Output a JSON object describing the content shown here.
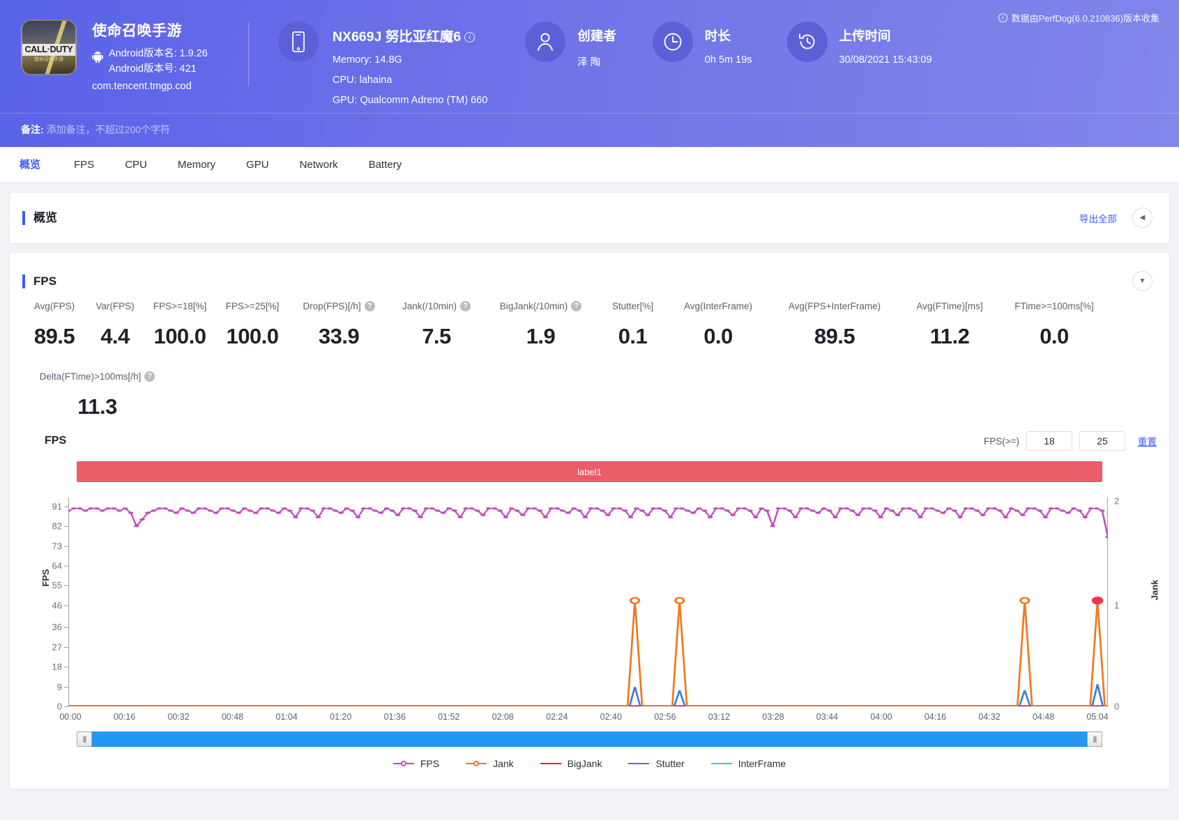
{
  "header": {
    "app": {
      "icon_title": "CALL·DUTY",
      "icon_sub": "使命召唤手游",
      "name": "使命召唤手游",
      "android_icon": "android-icon",
      "version_name": "Android版本名: 1.9.26",
      "version_code": "Android版本号: 421",
      "package": "com.tencent.tmgp.cod"
    },
    "device": {
      "icon": "phone-icon",
      "name": "NX669J 努比亚红魔6",
      "info_icon": "info-icon",
      "memory": "Memory: 14.8G",
      "cpu": "CPU: lahaina",
      "gpu": "GPU: Qualcomm Adreno (TM) 660"
    },
    "creator": {
      "icon": "user-icon",
      "title": "创建者",
      "value": "泽 陶"
    },
    "duration": {
      "icon": "clock-icon",
      "title": "时长",
      "value": "0h 5m 19s"
    },
    "upload": {
      "icon": "history-icon",
      "title": "上传时间",
      "value": "30/08/2021 15:43:09"
    },
    "collect_note": "数据由PerfDog(6.0.210836)版本收集",
    "note_label": "备注:",
    "note_placeholder": "添加备注，不超过200个字符"
  },
  "tabs": [
    {
      "label": "概览",
      "active": true
    },
    {
      "label": "FPS",
      "active": false
    },
    {
      "label": "CPU",
      "active": false
    },
    {
      "label": "Memory",
      "active": false
    },
    {
      "label": "GPU",
      "active": false
    },
    {
      "label": "Network",
      "active": false
    },
    {
      "label": "Battery",
      "active": false
    }
  ],
  "overview_card": {
    "title": "概览",
    "export_label": "导出全部",
    "collapse_icon": "chevron-left-icon"
  },
  "fps_card": {
    "title": "FPS",
    "expand_icon": "chevron-down-icon",
    "metrics": [
      {
        "label": "Avg(FPS)",
        "value": "89.5",
        "help": false
      },
      {
        "label": "Var(FPS)",
        "value": "4.4",
        "help": false
      },
      {
        "label": "FPS>=18[%]",
        "value": "100.0",
        "help": false
      },
      {
        "label": "FPS>=25[%]",
        "value": "100.0",
        "help": false
      },
      {
        "label": "Drop(FPS)[/h]",
        "value": "33.9",
        "help": true
      },
      {
        "label": "Jank(/10min)",
        "value": "7.5",
        "help": true
      },
      {
        "label": "BigJank(/10min)",
        "value": "1.9",
        "help": true
      },
      {
        "label": "Stutter[%]",
        "value": "0.1",
        "help": false
      },
      {
        "label": "Avg(InterFrame)",
        "value": "0.0",
        "help": false
      },
      {
        "label": "Avg(FPS+InterFrame)",
        "value": "89.5",
        "help": false
      },
      {
        "label": "Avg(FTime)[ms]",
        "value": "11.2",
        "help": false
      },
      {
        "label": "FTime>=100ms[%]",
        "value": "0.0",
        "help": false
      }
    ],
    "metrics_row2": [
      {
        "label": "Delta(FTime)>100ms[/h]",
        "value": "11.3",
        "help": true
      }
    ],
    "chart_header": {
      "name": "FPS",
      "fps_ge_label": "FPS(>=)",
      "threshold1": "18",
      "threshold2": "25",
      "reset_label": "重置"
    },
    "label_bar": "label1",
    "scrollbar": {
      "left_handle": "scroll-handle-left",
      "right_handle": "scroll-handle-right"
    }
  },
  "chart_data": {
    "type": "line",
    "title": "FPS",
    "xlabel": "",
    "ylabel": "FPS",
    "y2label": "Jank",
    "ylim": [
      0,
      95
    ],
    "y2lim": [
      0,
      2
    ],
    "yticks": [
      0,
      9,
      18,
      27,
      36,
      46,
      55,
      64,
      73,
      82,
      91
    ],
    "y2ticks": [
      0,
      1,
      2
    ],
    "xticks": [
      "00:00",
      "00:16",
      "00:32",
      "00:48",
      "01:04",
      "01:20",
      "01:36",
      "01:52",
      "02:08",
      "02:24",
      "02:40",
      "02:56",
      "03:12",
      "03:28",
      "03:44",
      "04:00",
      "04:16",
      "04:32",
      "04:48",
      "05:04"
    ],
    "grid": false,
    "legend_position": "bottom",
    "legend": [
      {
        "name": "FPS",
        "color": "#c24bbc",
        "marker": "circle"
      },
      {
        "name": "Jank",
        "color": "#f3761c",
        "marker": "circle"
      },
      {
        "name": "BigJank",
        "color": "#e02020",
        "marker": "line"
      },
      {
        "name": "Stutter",
        "color": "#3a7bd5",
        "marker": "line"
      },
      {
        "name": "InterFrame",
        "color": "#18d8d8",
        "marker": "line"
      }
    ],
    "series": [
      {
        "name": "FPS",
        "color": "#c24bbc",
        "axis": "left",
        "description": "Oscillates between ~82 and ~91 across the whole 5m19s run, with periodic small dips to 82-85 and a trailing drop to ~77 at the end.",
        "values": [
          89,
          90,
          90,
          89,
          90,
          90,
          89,
          90,
          90,
          89,
          90,
          88,
          82,
          85,
          88,
          89,
          90,
          90,
          89,
          88,
          90,
          89,
          88,
          90,
          90,
          89,
          88,
          90,
          90,
          89,
          88,
          90,
          89,
          88,
          90,
          90,
          89,
          88,
          90,
          89,
          86,
          90,
          90,
          89,
          86,
          90,
          90,
          89,
          88,
          90,
          89,
          86,
          90,
          90,
          89,
          88,
          90,
          89,
          87,
          90,
          90,
          89,
          86,
          90,
          90,
          89,
          88,
          90,
          89,
          86,
          90,
          90,
          89,
          87,
          90,
          90,
          89,
          86,
          90,
          89,
          87,
          90,
          90,
          89,
          86,
          90,
          90,
          89,
          88,
          90,
          89,
          86,
          90,
          90,
          89,
          87,
          90,
          90,
          89,
          86,
          90,
          89,
          87,
          90,
          90,
          89,
          86,
          90,
          90,
          89,
          88,
          90,
          89,
          86,
          90,
          90,
          89,
          87,
          90,
          90,
          89,
          86,
          90,
          89,
          82,
          90,
          90,
          89,
          86,
          90,
          90,
          89,
          88,
          90,
          89,
          86,
          90,
          90,
          89,
          87,
          90,
          90,
          89,
          86,
          90,
          89,
          87,
          90,
          90,
          89,
          86,
          90,
          90,
          89,
          88,
          90,
          89,
          86,
          90,
          90,
          89,
          87,
          90,
          90,
          89,
          86,
          90,
          89,
          87,
          90,
          90,
          89,
          86,
          90,
          90,
          89,
          88,
          90,
          89,
          86,
          90,
          90,
          89,
          77
        ]
      },
      {
        "name": "Jank",
        "color": "#f3761c",
        "axis": "right",
        "description": "Zero for most of the run, with four single-sample spikes to 1 at roughly 02:54, 03:08, 04:48 and 05:17 (the final one is highlighted with a filled red marker).",
        "spikes": [
          {
            "time": "02:54",
            "value": 1
          },
          {
            "time": "03:08",
            "value": 1
          },
          {
            "time": "04:48",
            "value": 1
          },
          {
            "time": "05:17",
            "value": 1,
            "highlighted": true
          }
        ]
      },
      {
        "name": "BigJank",
        "color": "#e02020",
        "axis": "right",
        "description": "Flat at 0 for the whole run.",
        "values": []
      },
      {
        "name": "Stutter",
        "color": "#3a7bd5",
        "axis": "left",
        "description": "Near zero throughout, with small spikes to about 7-8 FPS-scale units coinciding with the Jank spikes at 02:54, 03:08, 04:48 and 05:17.",
        "spikes": [
          {
            "time": "02:54",
            "value": 8
          },
          {
            "time": "03:08",
            "value": 7
          },
          {
            "time": "04:48",
            "value": 7
          },
          {
            "time": "05:17",
            "value": 9
          }
        ]
      },
      {
        "name": "InterFrame",
        "color": "#18d8d8",
        "axis": "left",
        "description": "Flat at 0 for the whole run.",
        "values": []
      }
    ]
  }
}
